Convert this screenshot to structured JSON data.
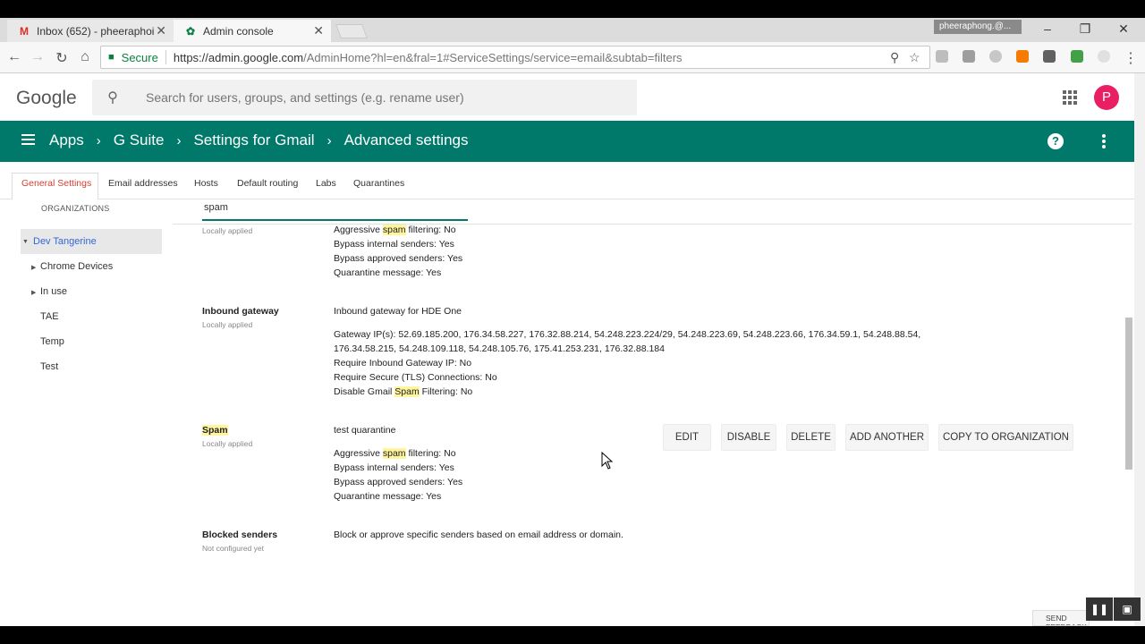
{
  "browser": {
    "tabs": [
      {
        "label": "Inbox (652) - pheeraphoi",
        "icon": "gmail-icon",
        "active": false
      },
      {
        "label": "Admin console",
        "icon": "admin-console-icon",
        "active": true
      }
    ],
    "profile_label": "pheeraphong.@...",
    "secure_label": "Secure",
    "url_host": "https://admin.google.com",
    "url_rest": "/AdminHome?hl=en&fral=1#ServiceSettings/service=email&subtab=filters"
  },
  "header": {
    "logo": "Google",
    "search_placeholder": "Search for users, groups, and settings (e.g. rename user)",
    "avatar_letter": "P",
    "avatar_color": "#e91e63"
  },
  "breadcrumb": {
    "items": [
      "Apps",
      "G Suite",
      "Settings for Gmail",
      "Advanced settings"
    ],
    "bar_color": "#00796b"
  },
  "subtabs": [
    "General Settings",
    "Email addresses",
    "Hosts",
    "Default routing",
    "Labs",
    "Quarantines"
  ],
  "orgs": {
    "heading": "ORGANIZATIONS",
    "items": [
      "Dev Tangerine",
      "Chrome Devices",
      "In use",
      "TAE",
      "Temp",
      "Test"
    ]
  },
  "filter": {
    "value": "spam"
  },
  "settings": {
    "first": {
      "sub": "Locally applied",
      "lines": [
        {
          "pre": "Aggressive ",
          "hl": "spam",
          "post": " filtering:   No"
        },
        {
          "pre": "Bypass internal senders:   Yes"
        },
        {
          "pre": "Bypass approved senders:   Yes"
        },
        {
          "pre": "Quarantine message:   Yes"
        }
      ]
    },
    "inbound": {
      "name": "Inbound gateway",
      "sub": "Locally applied",
      "title": "Inbound gateway for HDE One",
      "gateway_ips_1": "Gateway IP(s):   52.69.185.200, 176.34.58.227, 176.32.88.214, 54.248.223.224/29, 54.248.223.69, 54.248.223.66, 176.34.59.1, 54.248.88.54,",
      "gateway_ips_2": "176.34.58.215, 54.248.109.118, 54.248.105.76, 175.41.253.231, 176.32.88.184",
      "require_ip": "Require Inbound Gateway IP:   No",
      "require_tls": "Require Secure (TLS) Connections:   No",
      "disable_pre": "Disable Gmail ",
      "disable_hl": "Spam",
      "disable_post": " Filtering:   No"
    },
    "spam": {
      "name": "Spam",
      "sub": "Locally applied",
      "title": "test quarantine",
      "line1_pre": "Aggressive ",
      "line1_hl": "spam",
      "line1_post": " filtering:   No",
      "line2": "Bypass internal senders:   Yes",
      "line3": "Bypass approved senders:   Yes",
      "line4": "Quarantine message:   Yes",
      "buttons": [
        "EDIT",
        "DISABLE",
        "DELETE",
        "ADD ANOTHER",
        "COPY TO ORGANIZATION"
      ]
    },
    "blocked": {
      "name": "Blocked senders",
      "sub": "Not configured yet",
      "desc": "Block or approve specific senders based on email address or domain."
    }
  },
  "send_feedback": "SEND FEEDBACK"
}
